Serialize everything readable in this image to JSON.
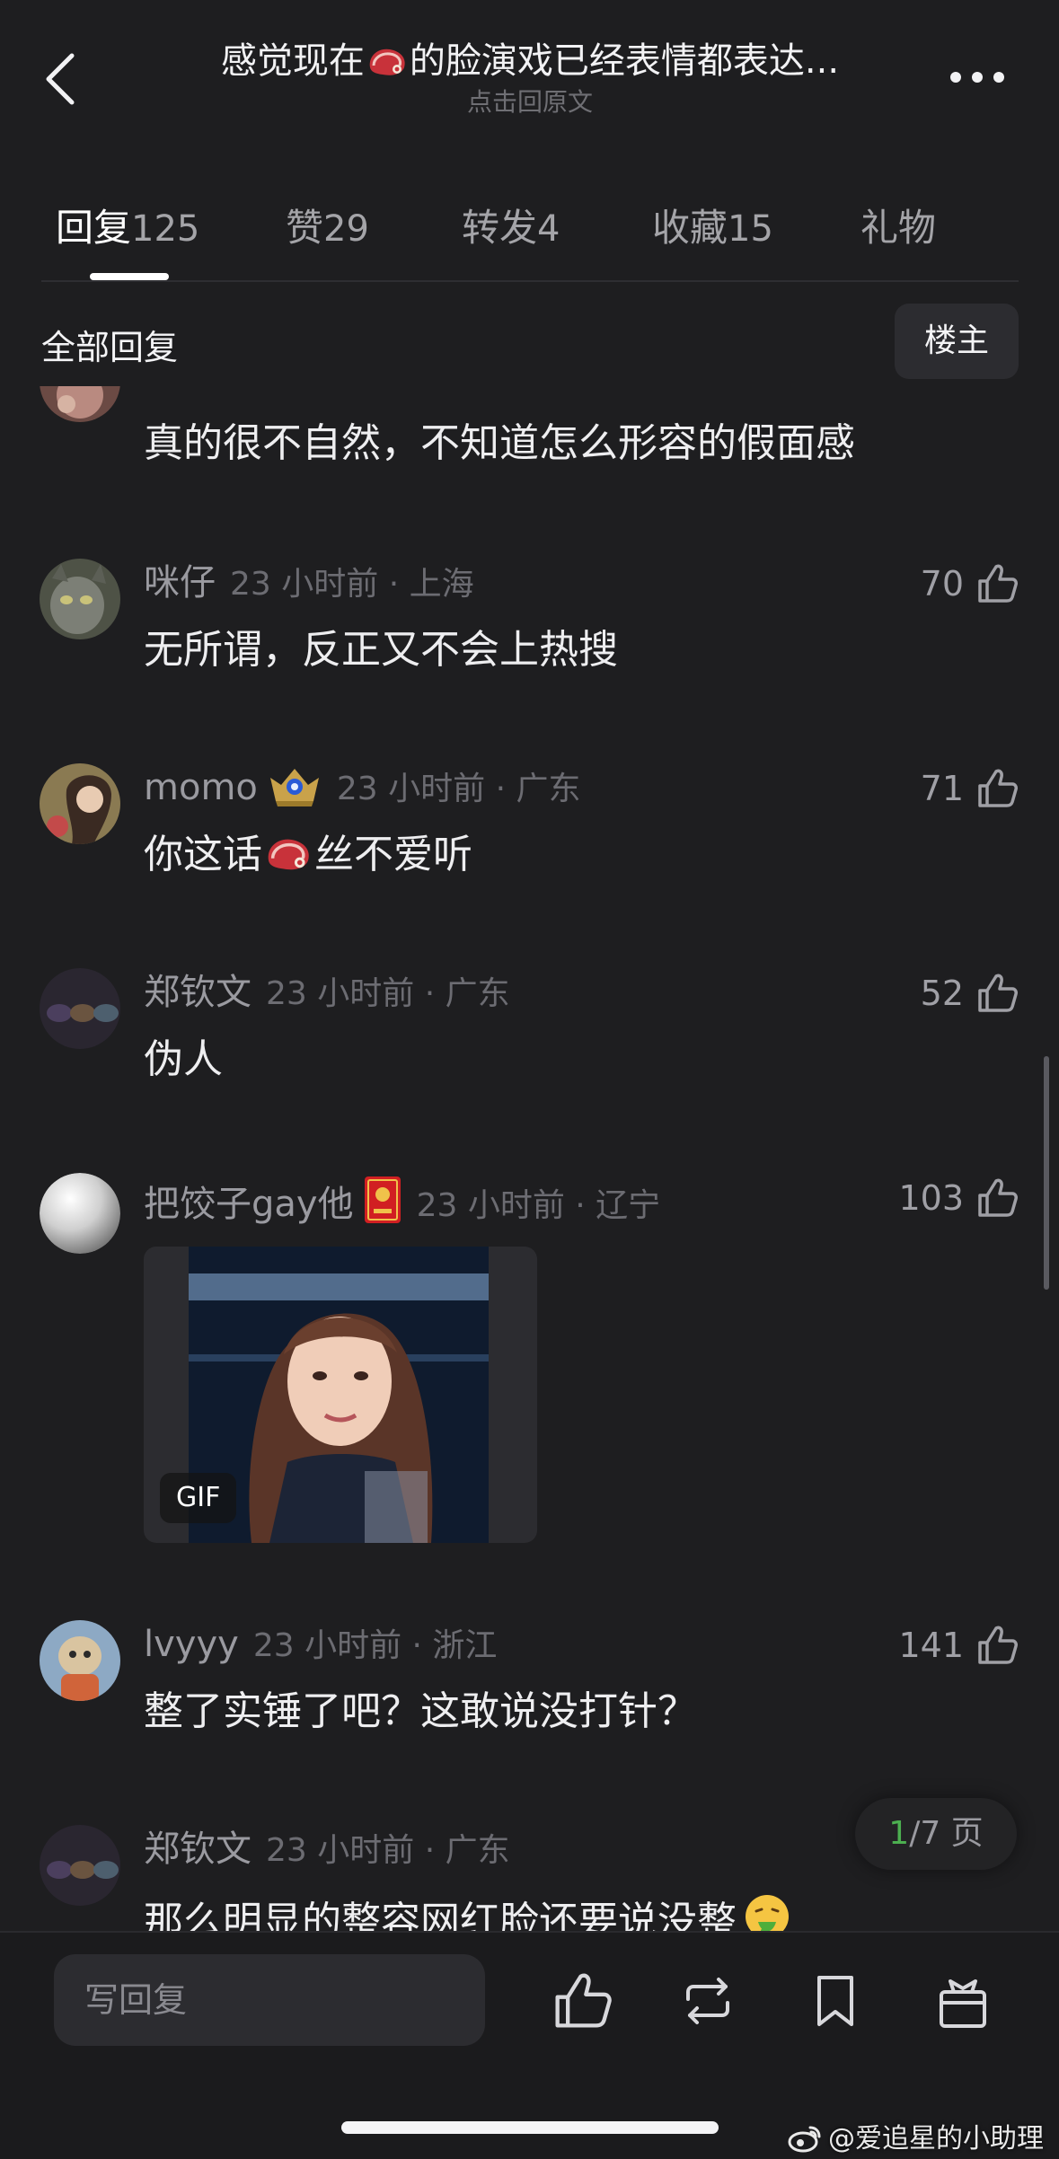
{
  "header": {
    "title_before": "感觉现在",
    "title_after": "的脸演戏已经表情都表达...",
    "subtitle": "点击回原文",
    "icons": {
      "back": "chevron-left-icon",
      "more": "more-dots-icon",
      "title_emoji": "meat-emoji-icon"
    }
  },
  "tabs": [
    {
      "label": "回复",
      "count": "125",
      "active": true
    },
    {
      "label": "赞",
      "count": "29",
      "active": false
    },
    {
      "label": "转发",
      "count": "4",
      "active": false
    },
    {
      "label": "收藏",
      "count": "15",
      "active": false
    },
    {
      "label": "礼物",
      "count": "",
      "active": false
    }
  ],
  "filter": {
    "label": "全部回复",
    "op_button": "楼主"
  },
  "comments": [
    {
      "text": "真的很不自然，不知道怎么形容的假面感"
    },
    {
      "name": "咪仔",
      "meta": "23 小时前 · 上海",
      "likes": "70",
      "text": "无所谓，反正又不会上热搜"
    },
    {
      "name": "momo",
      "meta": "23 小时前 · 广东",
      "likes": "71",
      "text_before": "你这话",
      "text_after": "丝不爱听",
      "badge_icon": "crown-badge-icon"
    },
    {
      "name": "郑钦文",
      "meta": "23 小时前 · 广东",
      "likes": "52",
      "text": "伪人"
    },
    {
      "name": "把饺子gay他",
      "meta": "23 小时前 · 辽宁",
      "likes": "103",
      "badge_icon": "red-envelope-badge-icon",
      "media_label": "GIF"
    },
    {
      "name": "lvyyy",
      "meta": "23 小时前 · 浙江",
      "likes": "141",
      "text": "整了实锤了吧？这敢说没打针？"
    },
    {
      "name": "郑钦文",
      "meta": "23 小时前 · 广东",
      "text": "那么明显的整容网红脸还要说没整",
      "emoji": "vomit-emoji-icon"
    }
  ],
  "pagination": {
    "current": "1",
    "rest": "/7 页"
  },
  "bottom_bar": {
    "reply_placeholder": "写回复",
    "icons": [
      "like-icon",
      "repost-icon",
      "bookmark-icon",
      "gift-icon"
    ]
  },
  "watermark": "@爱追星的小助理",
  "colors": {
    "background": "#1e1e20",
    "page_current": "#4caf50"
  }
}
